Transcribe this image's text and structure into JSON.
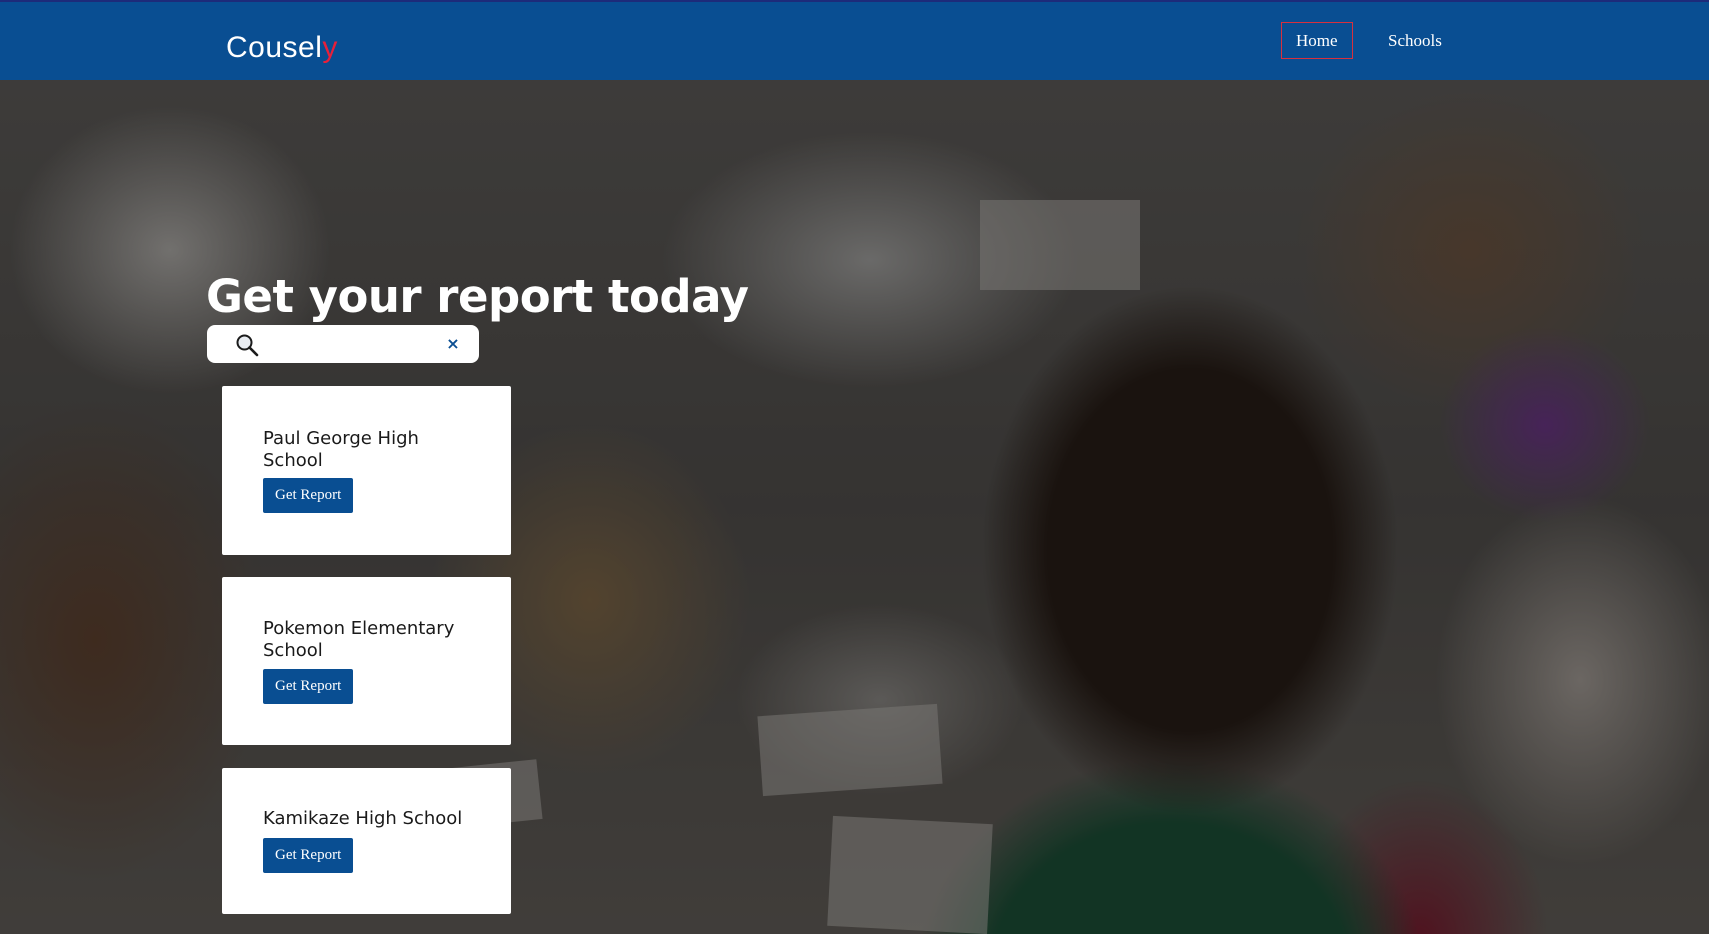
{
  "navbar": {
    "brand_main": "Cousel",
    "brand_accent": "y",
    "links": [
      {
        "label": "Home",
        "active": true
      },
      {
        "label": "Schools",
        "active": false
      }
    ]
  },
  "hero": {
    "headline": "Get your report today"
  },
  "search": {
    "placeholder": "",
    "value": "",
    "search_icon": "magnifier-icon",
    "clear_icon": "close-icon",
    "clear_glyph": "×"
  },
  "schools": [
    {
      "name": "Paul George High School",
      "button_label": "Get Report"
    },
    {
      "name": "Pokemon Elementary School",
      "button_label": "Get Report"
    },
    {
      "name": "Kamikaze High School",
      "button_label": "Get Report"
    }
  ],
  "colors": {
    "nav_background": "#094e92",
    "brand_accent": "#e8203a",
    "active_link_border": "#d8303d",
    "button_background": "#094e92"
  }
}
